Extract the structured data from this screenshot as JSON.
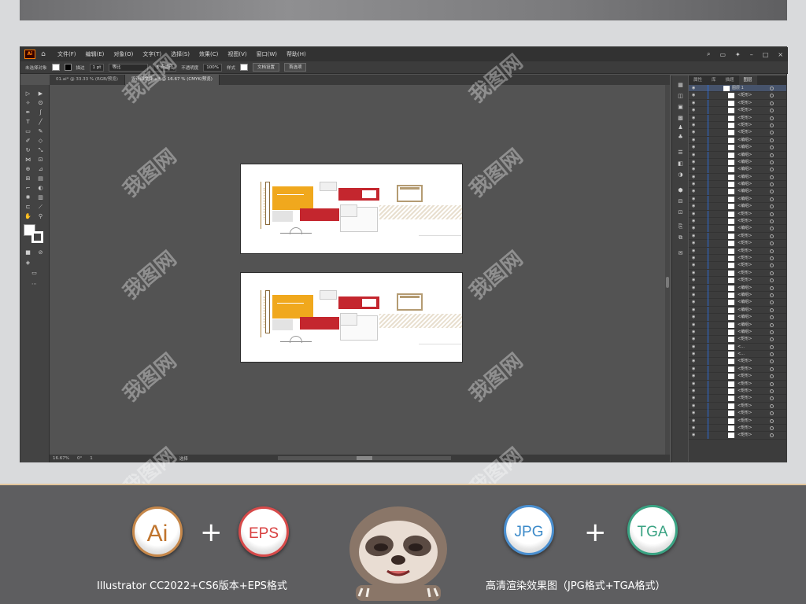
{
  "window": {
    "menu": [
      "文件(F)",
      "编辑(E)",
      "对象(O)",
      "文字(T)",
      "选择(S)",
      "效果(C)",
      "视图(V)",
      "窗口(W)",
      "帮助(H)"
    ],
    "logo": "Ai"
  },
  "control_bar": {
    "selection_label": "未选择对象",
    "stroke_label": "描边",
    "stroke_width": "1 pt",
    "stroke_style": "等比",
    "brush": "5 点圆形",
    "opacity_label": "不透明度",
    "opacity_value": "100%",
    "style_label": "样式",
    "doc_setup_button": "文档设置",
    "prefs_button": "首选项"
  },
  "tabs": [
    {
      "label": "01.ai* @ 33.33 % (RGB/预览)",
      "active": false
    },
    {
      "label": "设计原文件.ai* @ 16.67 % (CMYK/预览)",
      "active": true
    }
  ],
  "statusbar": {
    "zoom": "16.67%",
    "angle": "0°",
    "page": "1",
    "tool": "选择"
  },
  "panel": {
    "tabs": [
      "属性",
      "库",
      "描题",
      "图层"
    ],
    "active_tab": "图层",
    "top_layer": "图层 1",
    "rows": [
      "<矩形>",
      "<矩形>",
      "<矩形>",
      "<矩形>",
      "<矩形>",
      "<矩形>",
      "<编组>",
      "<编组>",
      "<编组>",
      "<编组>",
      "<编组>",
      "<编组>",
      "<编组>",
      "<编组>",
      "<编组>",
      "<编组>",
      "<矩形>",
      "<矩形>",
      "<编组>",
      "<矩形>",
      "<矩形>",
      "<矩形>",
      "<矩形>",
      "<矩形>",
      "<矩形>",
      "<矩形>",
      "<编组>",
      "<编组>",
      "<编组>",
      "<编组>",
      "<编组>",
      "<编组>",
      "<编组>",
      "<矩形>",
      "<...",
      "<...",
      "<矩形>",
      "<矩形>",
      "<矩形>",
      "<矩形>",
      "<矩形>",
      "<矩形>",
      "<矩形>",
      "<矩形>",
      "<矩形>",
      "<矩形>",
      "<矩形>"
    ]
  },
  "footer": {
    "badge_ai": "Ai",
    "badge_eps": "EPS",
    "badge_jpg": "JPG",
    "badge_tga": "TGA",
    "plus": "+",
    "caption_left": "Illustrator CC2022+CS6版本+EPS格式",
    "caption_right": "高清渲染效果图（JPG格式+TGA格式）"
  },
  "watermark": "我图网",
  "colors": {
    "accent_yellow": "#f0a81d",
    "accent_red": "#c4262e",
    "accent_tan": "#b49b72",
    "footer_bg": "#5e5e60",
    "divider": "#e3c69c"
  }
}
